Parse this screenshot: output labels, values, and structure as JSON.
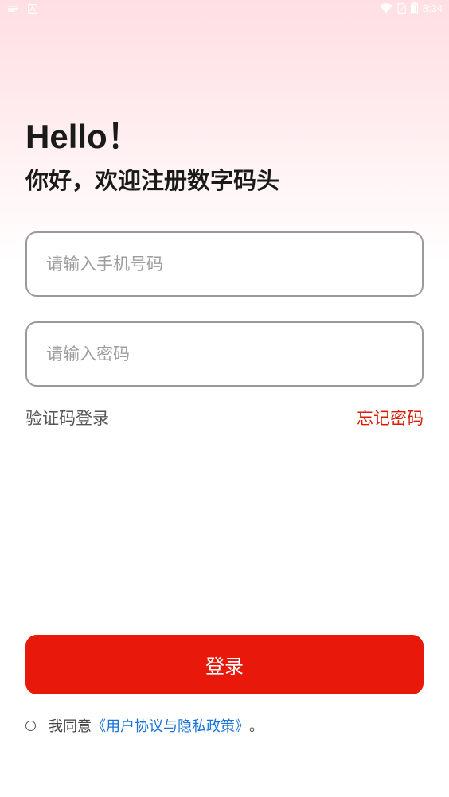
{
  "status_bar": {
    "time": "8:34",
    "icons": [
      "notification-icon",
      "keyboard-icon",
      "wifi-icon",
      "sim-icon",
      "battery-icon"
    ]
  },
  "header": {
    "hello": "Hello！",
    "subtitle": "你好，欢迎注册数字码头"
  },
  "form": {
    "phone_placeholder": "请输入手机号码",
    "phone_value": "",
    "password_placeholder": "请输入密码",
    "password_value": ""
  },
  "links": {
    "sms_login": "验证码登录",
    "forgot_password": "忘记密码"
  },
  "login_button": {
    "label": "登录"
  },
  "agreement": {
    "checked": false,
    "prefix": "我同意",
    "link": "《用户协议与隐私政策》",
    "suffix": "。"
  },
  "colors": {
    "primary": "#e8180a",
    "forgot_link": "#d81e06",
    "agreement_link": "#1a73d9",
    "gradient_top": "#ffdfe3"
  }
}
